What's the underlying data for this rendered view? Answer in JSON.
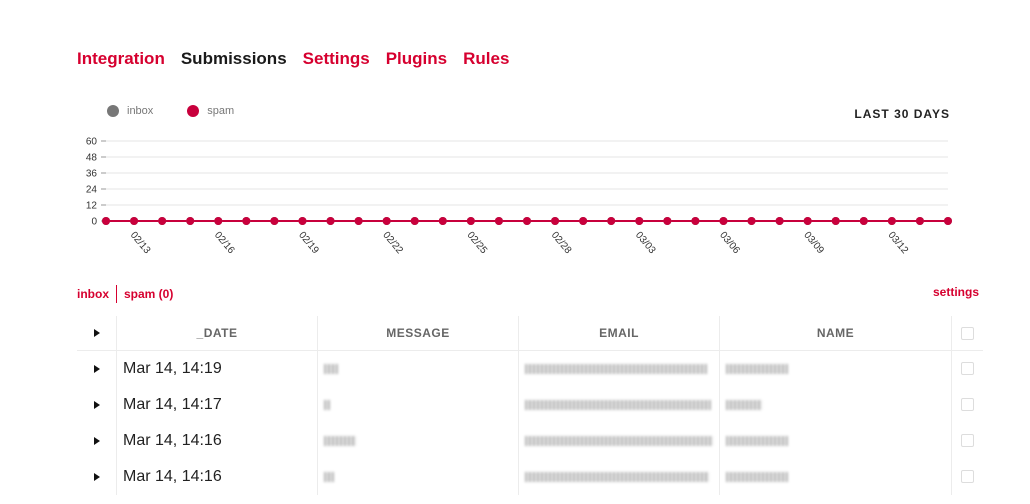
{
  "nav": {
    "tabs": [
      {
        "label": "Integration"
      },
      {
        "label": "Submissions"
      },
      {
        "label": "Settings"
      },
      {
        "label": "Plugins"
      },
      {
        "label": "Rules"
      }
    ],
    "active": "Submissions"
  },
  "legend": [
    {
      "label": "inbox",
      "color": "#777777"
    },
    {
      "label": "spam",
      "color": "#c8003c"
    }
  ],
  "range_label": "LAST 30 DAYS",
  "chart_data": {
    "type": "line",
    "x": [
      "02/12",
      "02/13",
      "02/14",
      "02/15",
      "02/16",
      "02/17",
      "02/18",
      "02/19",
      "02/20",
      "02/21",
      "02/22",
      "02/23",
      "02/24",
      "02/25",
      "02/26",
      "02/27",
      "02/28",
      "03/01",
      "03/02",
      "03/03",
      "03/04",
      "03/05",
      "03/06",
      "03/07",
      "03/08",
      "03/09",
      "03/10",
      "03/11",
      "03/12",
      "03/13",
      "03/14"
    ],
    "xtick_labels": [
      "02/13",
      "02/16",
      "02/19",
      "02/22",
      "02/25",
      "02/28",
      "03/03",
      "03/06",
      "03/09",
      "03/12"
    ],
    "series": [
      {
        "name": "inbox",
        "color": "#777777",
        "values": [
          0,
          0,
          0,
          0,
          0,
          0,
          0,
          0,
          0,
          0,
          0,
          0,
          0,
          0,
          0,
          0,
          0,
          0,
          0,
          0,
          0,
          0,
          0,
          0,
          0,
          0,
          0,
          0,
          0,
          0,
          0
        ]
      },
      {
        "name": "spam",
        "color": "#c8003c",
        "values": [
          0,
          0,
          0,
          0,
          0,
          0,
          0,
          0,
          0,
          0,
          0,
          0,
          0,
          0,
          0,
          0,
          0,
          0,
          0,
          0,
          0,
          0,
          0,
          0,
          0,
          0,
          0,
          0,
          0,
          0,
          0
        ]
      }
    ],
    "yticks": [
      0,
      12,
      24,
      36,
      48,
      60
    ],
    "ylim": [
      0,
      60
    ],
    "grid": true
  },
  "subtabs": {
    "inbox": "inbox",
    "spam": "spam (0)"
  },
  "settings_label": "settings",
  "table": {
    "headers": [
      "_DATE",
      "MESSAGE",
      "EMAIL",
      "NAME"
    ],
    "rows": [
      {
        "date": "Mar 14, 14:19"
      },
      {
        "date": "Mar 14, 14:17"
      },
      {
        "date": "Mar 14, 14:16"
      },
      {
        "date": "Mar 14, 14:16"
      }
    ]
  }
}
